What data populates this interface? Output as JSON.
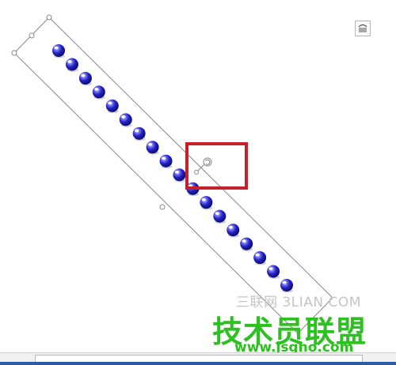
{
  "watermark": {
    "site_line": "三联网 3LIAN.COM",
    "brand": "技术员联盟",
    "url": "www.jsgho.com"
  },
  "shape": {
    "bead_count": 18,
    "bead_color": "#2a2ac8",
    "frame_color": "#888888"
  },
  "highlight": {
    "color": "#c8202a"
  },
  "icons": {
    "layout_options": "layout-options-icon",
    "rotate_handle": "rotate-handle-icon"
  }
}
